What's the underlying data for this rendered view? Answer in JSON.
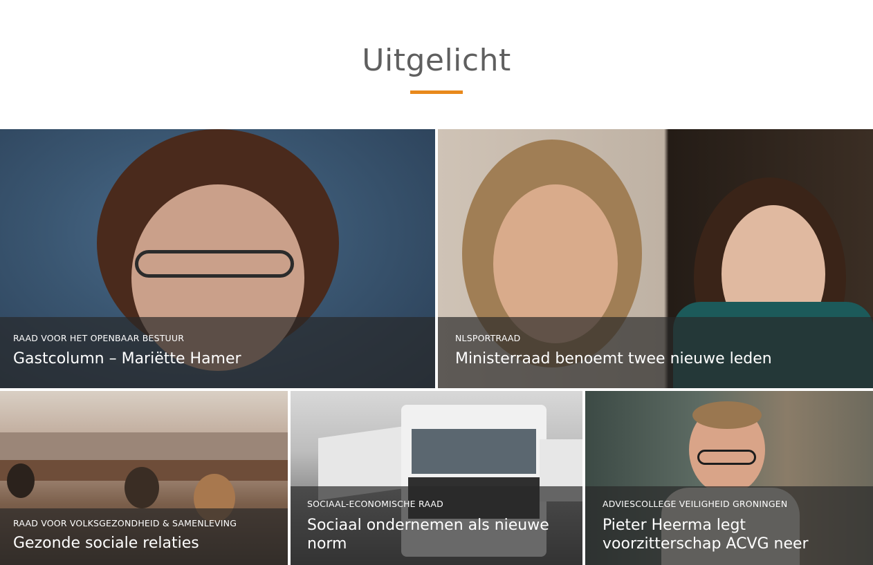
{
  "section": {
    "title": "Uitgelicht",
    "accent_color": "#e8891c"
  },
  "cards": [
    {
      "category": "RAAD VOOR HET OPENBAAR BESTUUR",
      "headline": "Gastcolumn – Mariëtte Hamer"
    },
    {
      "category": "NLSPORTRAAD",
      "headline": "Ministerraad benoemt twee nieuwe leden"
    },
    {
      "category": "RAAD VOOR VOLKSGEZONDHEID & SAMENLEVING",
      "headline": "Gezonde sociale relaties"
    },
    {
      "category": "SOCIAAL-ECONOMISCHE RAAD",
      "headline": "Sociaal ondernemen als nieuwe norm"
    },
    {
      "category": "ADVIESCOLLEGE VEILIGHEID GRONINGEN",
      "headline": "Pieter Heerma legt voorzitterschap ACVG neer"
    }
  ]
}
